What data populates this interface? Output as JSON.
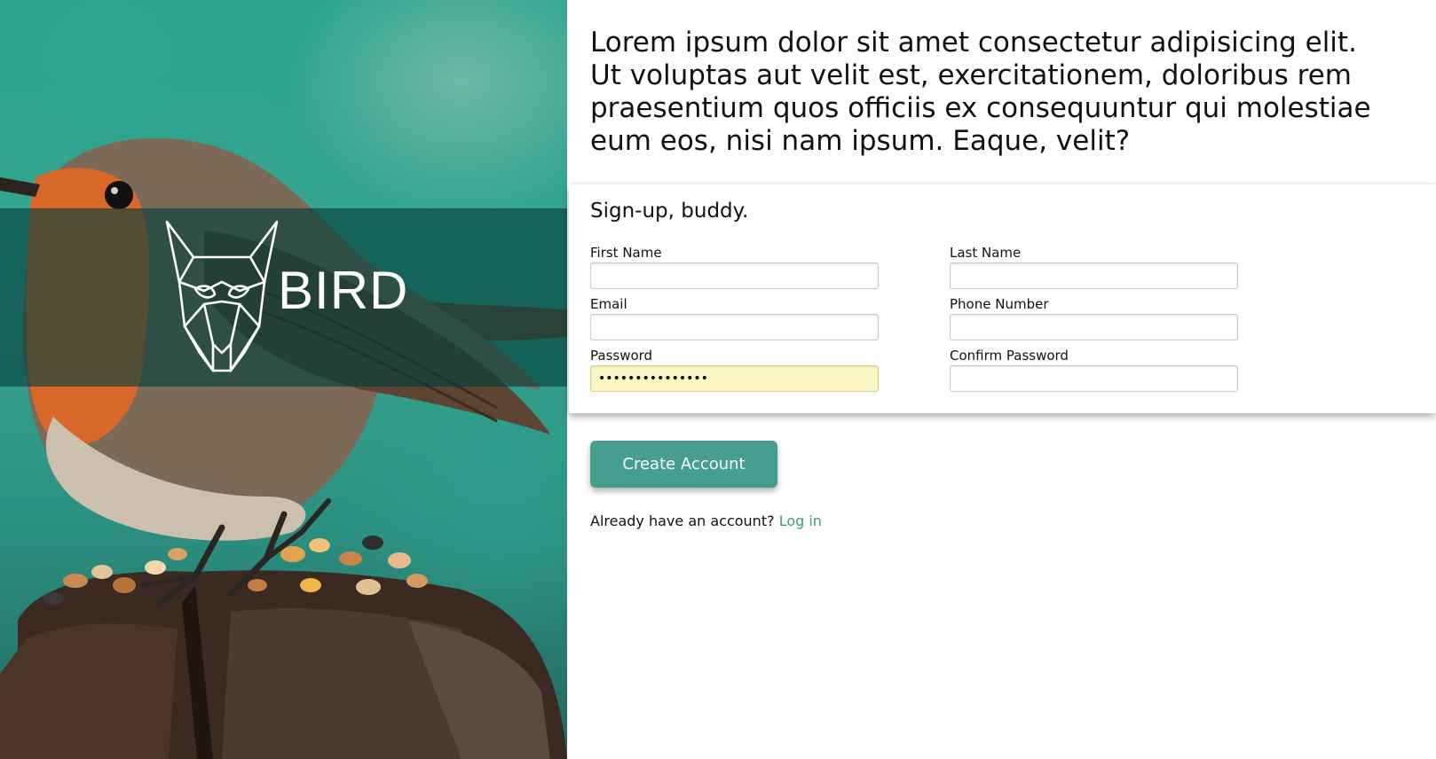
{
  "hero": {
    "brand_name": "BIRD",
    "logo_icon": "bird-head-geometric-icon",
    "background_image": "robin-on-feeder-photo"
  },
  "intro": {
    "text": "Lorem ipsum dolor sit amet consectetur adipisicing elit. Ut voluptas aut velit est, exercitationem, doloribus rem praesentium quos officiis ex consequuntur qui molestiae eum eos, nisi nam ipsum. Eaque, velit?"
  },
  "form": {
    "title": "Sign-up, buddy.",
    "first_name": {
      "label": "First Name",
      "value": ""
    },
    "last_name": {
      "label": "Last Name",
      "value": ""
    },
    "email": {
      "label": "Email",
      "value": ""
    },
    "phone": {
      "label": "Phone Number",
      "value": ""
    },
    "password": {
      "label": "Password",
      "value": "•••••••••••••••"
    },
    "confirm_password": {
      "label": "Confirm Password",
      "value": ""
    }
  },
  "actions": {
    "create_account_label": "Create Account",
    "login_prompt": "Already have an account?",
    "login_link": "Log in"
  },
  "colors": {
    "accent": "#469e8f",
    "link": "#3d9a8b",
    "autofill": "#fdf8c8",
    "brand_band": "#003e3a"
  }
}
